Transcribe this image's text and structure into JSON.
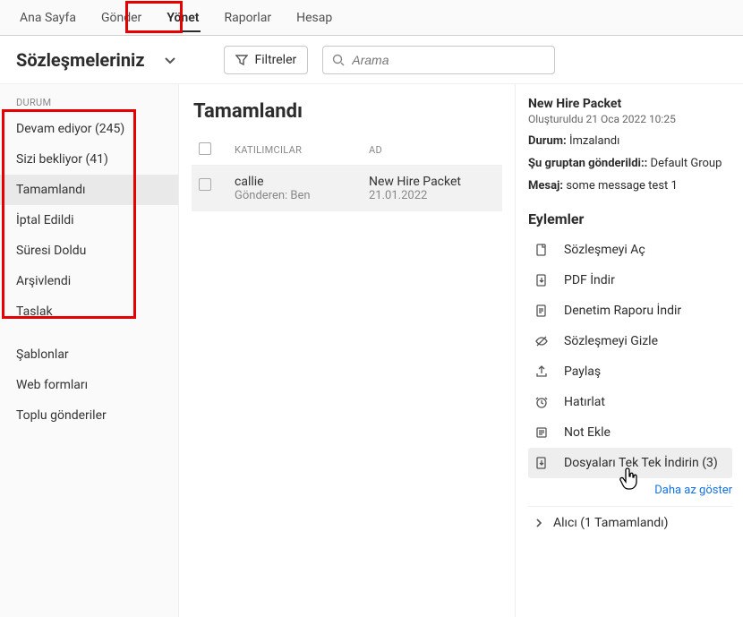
{
  "nav": {
    "items": [
      "Ana Sayfa",
      "Gönder",
      "Yönet",
      "Raporlar",
      "Hesap"
    ],
    "active_index": 2
  },
  "subheader": {
    "title": "Sözleşmeleriniz",
    "filter_label": "Filtreler",
    "search_placeholder": "Arama"
  },
  "sidebar": {
    "section_label": "DURUM",
    "status_items": [
      "Devam ediyor (245)",
      "Sizi bekliyor (41)",
      "Tamamlandı",
      "İptal Edildi",
      "Süresi Doldu",
      "Arşivlendi",
      "Taslak"
    ],
    "active_status_index": 2,
    "other_items": [
      "Şablonlar",
      "Web formları",
      "Toplu gönderiler"
    ]
  },
  "list": {
    "title": "Tamamlandı",
    "columns": {
      "participants": "KATILIMCILAR",
      "name": "AD"
    },
    "rows": [
      {
        "participant": "callie",
        "sender": "Gönderen: Ben",
        "name": "New Hire Packet",
        "date": "21.01.2022"
      }
    ]
  },
  "detail": {
    "title": "New Hire Packet",
    "created": "Oluşturuldu 21 Oca 2022 10:25",
    "status_label": "Durum:",
    "status_value": "İmzalandı",
    "group_label": "Şu gruptan gönderildi::",
    "group_value": "Default Group",
    "message_label": "Mesaj:",
    "message_value": "some message test 1",
    "actions_title": "Eylemler",
    "actions": [
      {
        "icon": "open-doc-icon",
        "label": "Sözleşmeyi Aç"
      },
      {
        "icon": "download-pdf-icon",
        "label": "PDF İndir"
      },
      {
        "icon": "download-report-icon",
        "label": "Denetim Raporu İndir"
      },
      {
        "icon": "hide-icon",
        "label": "Sözleşmeyi Gizle"
      },
      {
        "icon": "share-icon",
        "label": "Paylaş"
      },
      {
        "icon": "remind-icon",
        "label": "Hatırlat"
      },
      {
        "icon": "note-icon",
        "label": "Not Ekle"
      },
      {
        "icon": "download-files-icon",
        "label": "Dosyaları Tek Tek İndirin  (3)"
      }
    ],
    "hovered_action_index": 7,
    "more_label": "Daha az göster",
    "receiver_label": "Alıcı (1 Tamamlandı)"
  }
}
